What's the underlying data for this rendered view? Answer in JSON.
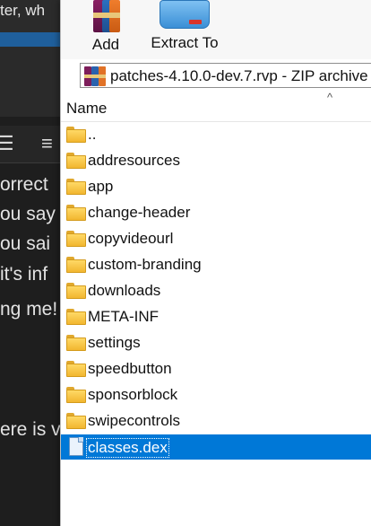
{
  "background": {
    "top_text": "ter, wh",
    "toolbar_icons": [
      "☰",
      "≡"
    ],
    "lines": [
      "orrect",
      "ou say",
      "ou sai",
      " it's inf",
      "ng me!",
      "ere is v"
    ]
  },
  "toolbar": {
    "add_label": "Add",
    "extract_label": "Extract To"
  },
  "address_bar": {
    "path": "patches-4.10.0-dev.7.rvp - ZIP archive"
  },
  "list": {
    "column_name": "Name",
    "sort_indicator": "^",
    "items": [
      {
        "name": "..",
        "type": "folder"
      },
      {
        "name": "addresources",
        "type": "folder"
      },
      {
        "name": "app",
        "type": "folder"
      },
      {
        "name": "change-header",
        "type": "folder"
      },
      {
        "name": "copyvideourl",
        "type": "folder"
      },
      {
        "name": "custom-branding",
        "type": "folder"
      },
      {
        "name": "downloads",
        "type": "folder"
      },
      {
        "name": "META-INF",
        "type": "folder"
      },
      {
        "name": "settings",
        "type": "folder"
      },
      {
        "name": "speedbutton",
        "type": "folder"
      },
      {
        "name": "sponsorblock",
        "type": "folder"
      },
      {
        "name": "swipecontrols",
        "type": "folder"
      },
      {
        "name": "classes.dex",
        "type": "file",
        "selected": true
      }
    ]
  },
  "colors": {
    "selection": "#0078d7",
    "folder": "#f2b630",
    "background_dark": "#1e1e1e",
    "accent_stripe": "#1f5f9c"
  }
}
